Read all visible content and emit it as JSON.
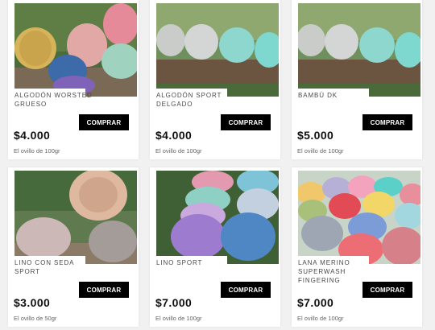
{
  "products": [
    {
      "name": "Algodón worsted grueso",
      "price": "$4.000",
      "unit": "El ovillo de 100gr",
      "buy_label": "COMPRAR"
    },
    {
      "name": "Algodón sport delgado",
      "price": "$4.000",
      "unit": "El ovillo de 100gr",
      "buy_label": "COMPRAR"
    },
    {
      "name": "Bambú DK",
      "price": "$5.000",
      "unit": "El ovillo de 100gr",
      "buy_label": "COMPRAR"
    },
    {
      "name": "Lino con seda sport",
      "price": "$3.000",
      "unit": "El ovillo de 50gr",
      "buy_label": "COMPRAR"
    },
    {
      "name": "Lino sport",
      "price": "$7.000",
      "unit": "El ovillo de 100gr",
      "buy_label": "COMPRAR"
    },
    {
      "name": "Lana merino superwash fingering",
      "price": "$7.000",
      "unit": "El ovillo de 100gr",
      "buy_label": "COMPRAR"
    }
  ]
}
